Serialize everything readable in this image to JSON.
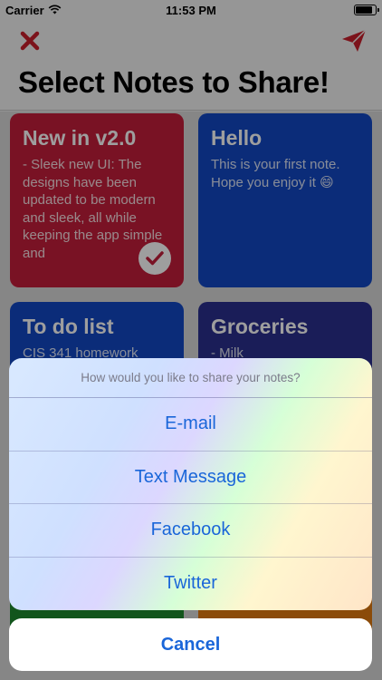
{
  "status_bar": {
    "carrier": "Carrier",
    "time": "11:53 PM"
  },
  "nav": {
    "close_icon": "close-x-icon",
    "send_icon": "paper-plane-icon",
    "accent_color": "#c8202c",
    "title": "Select Notes to Share!"
  },
  "notes": [
    {
      "title": "New in v2.0",
      "body": "- Sleek new UI: The designs have been updated to be modern and sleek, all while keeping the app simple and",
      "color": "#c41e3a",
      "selected": true
    },
    {
      "title": "Hello",
      "body": "This is your first note. Hope you enjoy it 😄",
      "color": "#1248c4",
      "selected": false
    },
    {
      "title": "To do list",
      "body": "CIS 341 homework",
      "color": "#1248c4",
      "selected": false
    },
    {
      "title": "Groceries",
      "body": "- Milk",
      "color": "#2a2f8f",
      "selected": false
    },
    {
      "title": "",
      "body": "",
      "color": "#1d8a2e",
      "selected": false
    },
    {
      "title": "",
      "body": "",
      "color": "#e07a10",
      "selected": false
    }
  ],
  "action_sheet": {
    "message": "How would you like to share your notes?",
    "options": [
      "E-mail",
      "Text Message",
      "Facebook",
      "Twitter"
    ],
    "cancel": "Cancel"
  }
}
